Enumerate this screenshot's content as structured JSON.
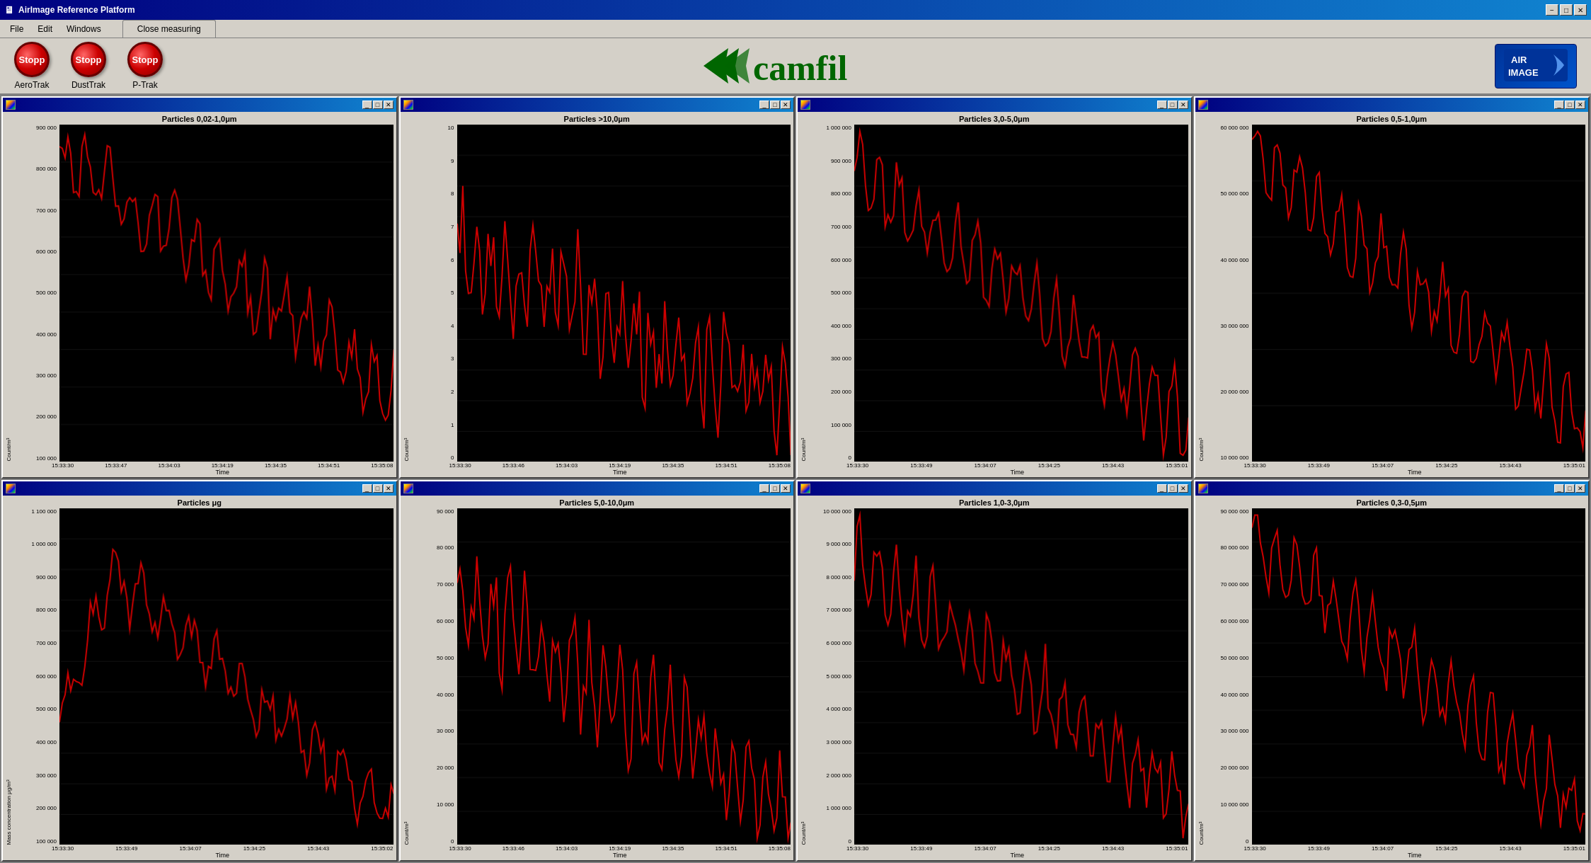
{
  "titlebar": {
    "title": "AirImage Reference Platform",
    "minimize": "−",
    "maximize": "□",
    "close": "✕"
  },
  "menubar": {
    "file": "File",
    "edit": "Edit",
    "windows": "Windows",
    "tab": "Close measuring"
  },
  "toolbar": {
    "buttons": [
      {
        "label": "Stopp",
        "name": "AeroTrak"
      },
      {
        "label": "Stopp",
        "name": "DustTrak"
      },
      {
        "label": "Stopp",
        "name": "P-Trak"
      }
    ]
  },
  "camfil": {
    "logo_text": "camfil"
  },
  "airimage": {
    "logo_text": "AIR\nIMAGE"
  },
  "charts": [
    {
      "title": "chart-1",
      "label": "Particles 0,02-1,0μm",
      "y_axis_label": "Count/m³",
      "y_ticks": [
        "900 000",
        "800 000",
        "700 000",
        "600 000",
        "500 000",
        "400 000",
        "300 000",
        "200 000",
        "100 000"
      ],
      "x_ticks": [
        "15:33:30",
        "15:33:47",
        "15:34:03",
        "15:34:19",
        "15:34:35",
        "15:34:51",
        "15:35:08"
      ],
      "x_label": "Time",
      "color": "#cc0000"
    },
    {
      "title": "chart-2",
      "label": "Particles >10,0μm",
      "y_axis_label": "Count/m³",
      "y_ticks": [
        "10",
        "9",
        "8",
        "7",
        "6",
        "5",
        "4",
        "3",
        "2",
        "1",
        "0"
      ],
      "x_ticks": [
        "15:33:30",
        "15:33:46",
        "15:34:03",
        "15:34:19",
        "15:34:35",
        "15:34:51",
        "15:35:08"
      ],
      "x_label": "Time",
      "color": "#cc0000"
    },
    {
      "title": "chart-3",
      "label": "Particles 3,0-5,0μm",
      "y_axis_label": "Count/m³",
      "y_ticks": [
        "1 000 000",
        "900 000",
        "800 000",
        "700 000",
        "600 000",
        "500 000",
        "400 000",
        "300 000",
        "200 000",
        "100 000",
        "0"
      ],
      "x_ticks": [
        "15:33:30",
        "15:33:49",
        "15:34:07",
        "15:34:25",
        "15:34:43",
        "15:35:01"
      ],
      "x_label": "Time",
      "color": "#cc0000"
    },
    {
      "title": "chart-4",
      "label": "Particles 0,5-1,0μm",
      "y_axis_label": "Count/m³",
      "y_ticks": [
        "60 000 000",
        "50 000 000",
        "40 000 000",
        "30 000 000",
        "20 000 000",
        "10 000 000"
      ],
      "x_ticks": [
        "15:33:30",
        "15:33:49",
        "15:34:07",
        "15:34:25",
        "15:34:43",
        "15:35:01"
      ],
      "x_label": "Time",
      "color": "#cc0000"
    },
    {
      "title": "chart-5",
      "label": "Particles μg",
      "y_axis_label": "Mass concentration μg/m³",
      "y_ticks": [
        "1 100 000",
        "1 000 000",
        "900 000",
        "800 000",
        "700 000",
        "600 000",
        "500 000",
        "400 000",
        "300 000",
        "200 000",
        "100 000"
      ],
      "x_ticks": [
        "15:33:30",
        "15:33:49",
        "15:34:07",
        "15:34:25",
        "15:34:43",
        "15:35:02"
      ],
      "x_label": "Time",
      "color": "#cc0000"
    },
    {
      "title": "chart-6",
      "label": "Particles 5,0-10,0μm",
      "y_axis_label": "Count/m³",
      "y_ticks": [
        "90 000",
        "80 000",
        "70 000",
        "60 000",
        "50 000",
        "40 000",
        "30 000",
        "20 000",
        "10 000",
        "0"
      ],
      "x_ticks": [
        "15:33:30",
        "15:33:46",
        "15:34:03",
        "15:34:19",
        "15:34:35",
        "15:34:51",
        "15:35:08"
      ],
      "x_label": "Time",
      "color": "#cc0000"
    },
    {
      "title": "chart-7",
      "label": "Particles 1,0-3,0μm",
      "y_axis_label": "Count/m³",
      "y_ticks": [
        "10 000 000",
        "9 000 000",
        "8 000 000",
        "7 000 000",
        "6 000 000",
        "5 000 000",
        "4 000 000",
        "3 000 000",
        "2 000 000",
        "1 000 000",
        "0"
      ],
      "x_ticks": [
        "15:33:30",
        "15:33:49",
        "15:34:07",
        "15:34:25",
        "15:34:43",
        "15:35:01"
      ],
      "x_label": "Time",
      "color": "#cc0000"
    },
    {
      "title": "chart-8",
      "label": "Particles 0,3-0,5μm",
      "y_axis_label": "Count/m³",
      "y_ticks": [
        "90 000 000",
        "80 000 000",
        "70 000 000",
        "60 000 000",
        "50 000 000",
        "40 000 000",
        "30 000 000",
        "20 000 000",
        "10 000 000",
        "0"
      ],
      "x_ticks": [
        "15:33:30",
        "15:33:49",
        "15:34:07",
        "15:34:25",
        "15:34:43",
        "15:35:01"
      ],
      "x_label": "Time",
      "color": "#cc0000"
    }
  ],
  "chart_window_controls": {
    "minimize": "_",
    "maximize": "□",
    "close": "✕"
  }
}
